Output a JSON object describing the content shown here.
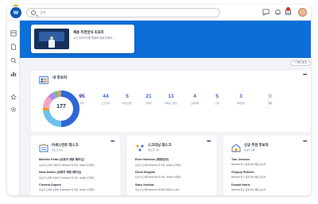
{
  "topbar": {
    "search_placeholder": "검색",
    "icons": [
      "chat-icon",
      "bell-icon",
      "inbox-icon"
    ]
  },
  "rail": {
    "icons": [
      "home-icon",
      "document-icon",
      "search-candidate-icon",
      "org-chart-icon",
      "star-icon",
      "settings-icon"
    ]
  },
  "welcome": {
    "title": "채용 추천방식 리포트",
    "subtitle": "소규 대리모드를 활용해 현재 판매이 ..."
  },
  "add_card_label": "+ 카드 추가",
  "candidates": {
    "title": "내 후보자",
    "total": "177",
    "stats": [
      {
        "value": "95",
        "label": "지원",
        "color": "#1f3a8a"
      },
      {
        "value": "44",
        "label": "스크리닝",
        "color": "#2f66d6"
      },
      {
        "value": "5",
        "label": "어세스먼트",
        "color": "#2f66d6"
      },
      {
        "value": "21",
        "label": "인터뷰",
        "color": "#2f66d6"
      },
      {
        "value": "13",
        "label": "레퍼런스 체크",
        "color": "#2f66d6"
      },
      {
        "value": "4",
        "label": "고용계약",
        "color": "#2f66d6"
      },
      {
        "value": "5",
        "label": "오퍼",
        "color": "#2f66d6"
      },
      {
        "value": "3",
        "label": "준비완료",
        "color": "#2f66d6"
      },
      {
        "value": "0",
        "label": "채용",
        "color": "#9ca3af"
      }
    ],
    "donut_segments": [
      {
        "value": 95,
        "color": "#2f66d6"
      },
      {
        "value": 44,
        "color": "#6ec1ef"
      },
      {
        "value": 5,
        "color": "#f59e0b"
      },
      {
        "value": 21,
        "color": "#f4a3c8"
      },
      {
        "value": 13,
        "color": "#b58ae6"
      },
      {
        "value": 4,
        "color": "#34d399"
      },
      {
        "value": 5,
        "color": "#fb923c"
      },
      {
        "value": 3,
        "color": "#9ca3af"
      }
    ]
  },
  "tasks": [
    {
      "title": "어세스먼트 태스크",
      "subtitle": "태스크 6개",
      "items": [
        {
          "name": "Michelle Pettis (모회가 채용 페어선)",
          "desc": "후보자 소개의 탄생성 및 6604449 럭 커피 - EMEA (인재풀)"
        },
        {
          "name": "Hans Molten (모회가 채용 페어선)",
          "desc": "후보자 소개의 탄생성 및 6604449 럭 커피 - EMEA (인재풀)"
        },
        {
          "name": "Clement Dupont",
          "desc": "후보자 소개의 탄생성 및 6604449 럭 커피 - EMEA (인재풀)"
        }
      ]
    },
    {
      "title": "스크리닝 태스크",
      "subtitle": "태스크 7개",
      "items": [
        {
          "name": "Peter Harleson (채용담당)",
          "desc": "후보자 소개의 6604449 럭 커피 - EMEA (인재풀)"
        },
        {
          "name": "David Delgado",
          "desc": "후보자 소개의 6604449 럭 커피 - EMEA (인재풀)"
        },
        {
          "name": "Saito Yoshida",
          "desc": "후보자 소개의 6604449 럭커피(인재풀)는 6604"
        }
      ]
    },
    {
      "title": "신규 추천 후보자",
      "subtitle": "후보자 6명",
      "items": [
        {
          "name": "Tom Johnson",
          "desc": "6604449 연구 회계 관련 채용 포지션"
        },
        {
          "name": "Gregory Roberts",
          "desc": "6604449 연구 회계 관련 채용 포지션"
        },
        {
          "name": "Donald Harris",
          "desc": "6604449 연구 회계 관련 채용 포지션"
        }
      ]
    }
  ]
}
